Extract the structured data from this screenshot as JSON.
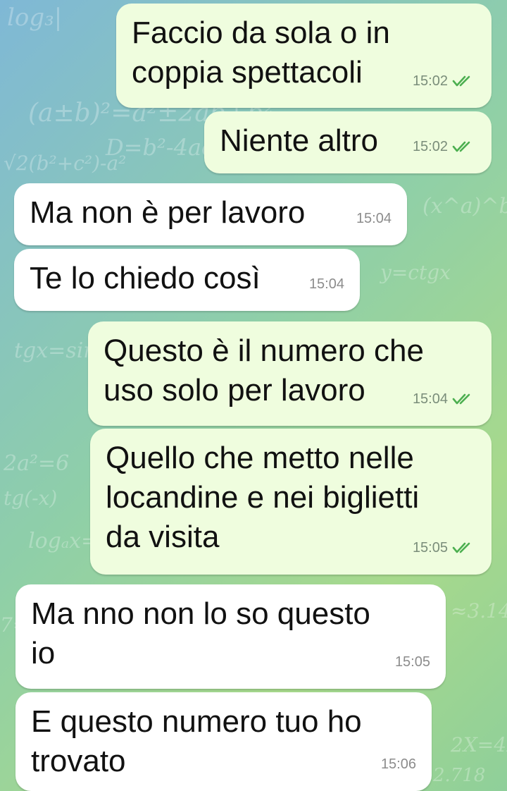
{
  "messages": [
    {
      "dir": "out",
      "text": "Faccio da sola o in\ncoppia spettacoli",
      "time": "15:02",
      "status": "read"
    },
    {
      "dir": "out",
      "text": "Niente altro",
      "time": "15:02",
      "status": "read"
    },
    {
      "dir": "in",
      "text": "Ma non è per lavoro",
      "time": "15:04"
    },
    {
      "dir": "in",
      "text": "Te lo chiedo così",
      "time": "15:04"
    },
    {
      "dir": "out",
      "text": "Questo è il numero che\nuso solo per lavoro",
      "time": "15:04",
      "status": "read"
    },
    {
      "dir": "out",
      "text": "Quello che metto nelle\nlocandine e nei biglietti\nda visita",
      "time": "15:05",
      "status": "read"
    },
    {
      "dir": "in",
      "text": "Ma nno non lo so questo\nio",
      "time": "15:05"
    },
    {
      "dir": "in",
      "text": "E questo numero tuo ho\ntrovato",
      "time": "15:06"
    }
  ],
  "colors": {
    "outgoing": "#effdde",
    "incoming": "#ffffff",
    "read_ticks": "#4caf50"
  },
  "icons": {
    "read_status": "double-check-icon"
  }
}
